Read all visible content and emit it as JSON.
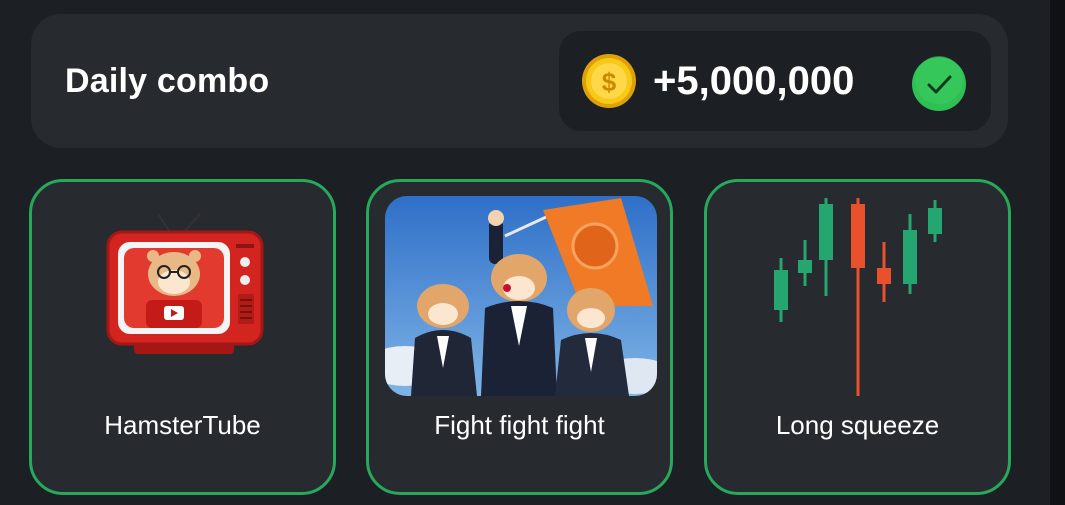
{
  "header": {
    "title": "Daily combo",
    "reward_amount": "+5,000,000",
    "reward_icon": "coin-icon",
    "status_icon": "checkmark-icon"
  },
  "cards": [
    {
      "label": "HamsterTube",
      "icon": "tv-hamster-icon"
    },
    {
      "label": "Fight fight fight",
      "icon": "hamsters-flag-image"
    },
    {
      "label": "Long squeeze",
      "icon": "candlestick-chart-icon"
    }
  ],
  "colors": {
    "accent_green": "#27a85a",
    "candle_green": "#25a56f",
    "candle_red": "#e8512b",
    "coin_gold": "#f5c518"
  }
}
